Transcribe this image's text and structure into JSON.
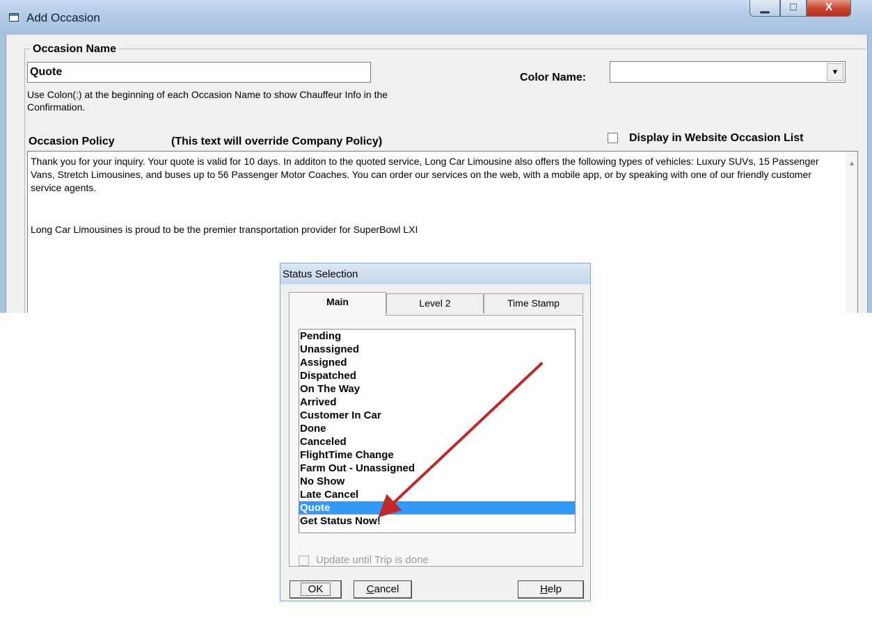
{
  "occasion_window": {
    "title": "Add Occasion",
    "group_label": "Occasion Name",
    "occasion_name_value": "Quote",
    "name_hint": "Use Colon(:) at the beginning of each Occasion Name to show Chauffeur Info in the Confirmation.",
    "color_label": "Color Name:",
    "color_value": "",
    "policy_label": "Occasion Policy",
    "policy_note": "(This text will override Company Policy)",
    "display_label": "Display in Website Occasion List",
    "display_checked": false,
    "policy_text_p1": "Thank you for your inquiry.  Your quote is valid for 10 days.  In additon to the quoted service, Long Car Limousine also offers the following types of vehicles:  Luxury SUVs, 15 Passenger Vans, Stretch Limousines, and buses up to 56 Passenger Motor Coaches.  You can order our services on the web, with a mobile app, or by speaking with one of our friendly customer service agents.",
    "policy_text_p2": "Long Car Limousines is proud to be the premier transportation provider for SuperBowl LXI",
    "caption_buttons": {
      "minimize": "▁",
      "maximize": "□",
      "close": "X"
    }
  },
  "status_dialog": {
    "title": "Status Selection",
    "tabs": [
      {
        "label": "Main",
        "active": true
      },
      {
        "label": "Level 2",
        "active": false
      },
      {
        "label": "Time Stamp",
        "active": false
      }
    ],
    "statuses": [
      "Pending",
      "Unassigned",
      "Assigned",
      "Dispatched",
      "On The Way",
      "Arrived",
      "Customer In Car",
      "Done",
      "Canceled",
      "FlightTime Change",
      "Farm Out - Unassigned",
      "No Show",
      "Late Cancel",
      "Quote",
      "Get Status Now!"
    ],
    "selected_status": "Quote",
    "update_label": "Update until Trip is done",
    "update_checked": false,
    "buttons": {
      "ok": "OK",
      "cancel": "Cancel",
      "help": "Help"
    }
  },
  "colors": {
    "selection": "#3399ff",
    "arrow": "#c0282a"
  }
}
